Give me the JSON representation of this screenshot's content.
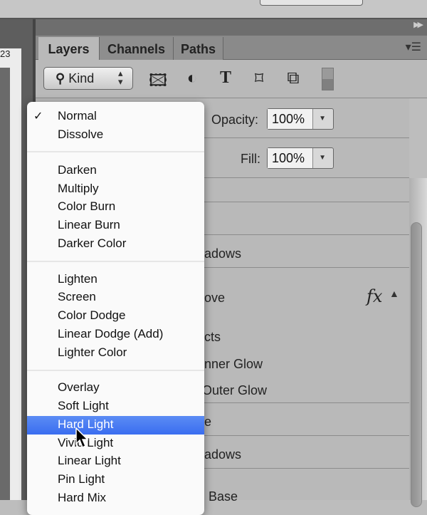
{
  "ruler": {
    "number": "23"
  },
  "panel": {
    "collapse_icon": "double-chevron-right",
    "menu_icon": "panel-menu",
    "tabs": [
      {
        "label": "Layers",
        "active": true
      },
      {
        "label": "Channels"
      },
      {
        "label": "Paths"
      }
    ]
  },
  "filter": {
    "kind_label": "Kind",
    "icons": [
      "image-filter-icon",
      "adjustment-filter-icon",
      "type-filter-icon",
      "shape-filter-icon",
      "smart-object-filter-icon",
      "filter-toggle"
    ]
  },
  "opacity": {
    "label": "Opacity:",
    "value": "100%"
  },
  "fill": {
    "label": "Fill:",
    "value": "100%"
  },
  "layers": [
    "adows",
    "ove",
    "fx",
    "cts",
    "nner Glow",
    "Outer Glow",
    "e",
    "adows",
    "Base"
  ],
  "blend_menu": {
    "selected": "Normal",
    "highlighted": "Hard Light",
    "items": [
      "Normal",
      "Dissolve",
      "Darken",
      "Multiply",
      "Color Burn",
      "Linear Burn",
      "Darker Color",
      "Lighten",
      "Screen",
      "Color Dodge",
      "Linear Dodge (Add)",
      "Lighter Color",
      "Overlay",
      "Soft Light",
      "Hard Light",
      "Vivid Light",
      "Linear Light",
      "Pin Light",
      "Hard Mix"
    ]
  },
  "colors": {
    "highlight": "#4a7cf2",
    "panel": "#b9b9b9"
  }
}
